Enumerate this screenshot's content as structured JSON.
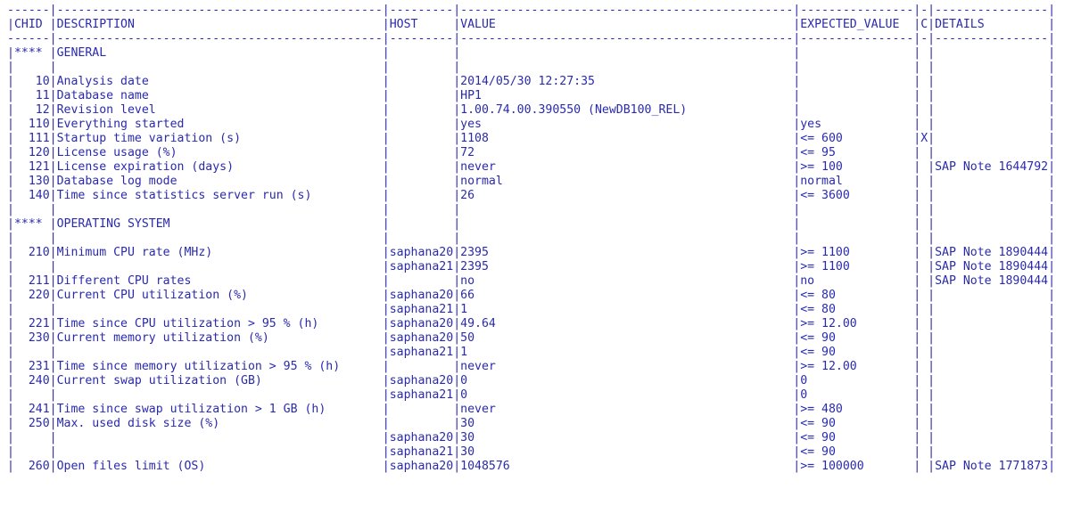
{
  "widths": {
    "chid": 5,
    "description": 46,
    "host": 9,
    "value": 47,
    "expected": 16,
    "c": 1,
    "details": 16
  },
  "header": {
    "chid": "CHID",
    "description": "DESCRIPTION",
    "host": "HOST",
    "value": "VALUE",
    "expected": "EXPECTED_VALUE",
    "c": "C",
    "details": "DETAILS"
  },
  "rows": [
    {
      "section": true,
      "chid": "****",
      "description": "GENERAL"
    },
    {
      "blank": true
    },
    {
      "chid": "10",
      "description": "Analysis date",
      "host": "",
      "value": "2014/05/30 12:27:35",
      "expected": "",
      "c": "",
      "details": ""
    },
    {
      "chid": "11",
      "description": "Database name",
      "host": "",
      "value": "HP1",
      "expected": "",
      "c": "",
      "details": ""
    },
    {
      "chid": "12",
      "description": "Revision level",
      "host": "",
      "value": "1.00.74.00.390550 (NewDB100_REL)",
      "expected": "",
      "c": "",
      "details": ""
    },
    {
      "chid": "110",
      "description": "Everything started",
      "host": "",
      "value": "yes",
      "expected": "yes",
      "c": "",
      "details": ""
    },
    {
      "chid": "111",
      "description": "Startup time variation (s)",
      "host": "",
      "value": "1108",
      "expected": "<= 600",
      "c": "X",
      "details": ""
    },
    {
      "chid": "120",
      "description": "License usage (%)",
      "host": "",
      "value": "72",
      "expected": "<= 95",
      "c": "",
      "details": ""
    },
    {
      "chid": "121",
      "description": "License expiration (days)",
      "host": "",
      "value": "never",
      "expected": ">= 100",
      "c": "",
      "details": "SAP Note 1644792"
    },
    {
      "chid": "130",
      "description": "Database log mode",
      "host": "",
      "value": "normal",
      "expected": "normal",
      "c": "",
      "details": ""
    },
    {
      "chid": "140",
      "description": "Time since statistics server run (s)",
      "host": "",
      "value": "26",
      "expected": "<= 3600",
      "c": "",
      "details": ""
    },
    {
      "blank": true
    },
    {
      "section": true,
      "chid": "****",
      "description": "OPERATING SYSTEM"
    },
    {
      "blank": true
    },
    {
      "chid": "210",
      "description": "Minimum CPU rate (MHz)",
      "host": "saphana20",
      "value": "2395",
      "expected": ">= 1100",
      "c": "",
      "details": "SAP Note 1890444"
    },
    {
      "chid": "",
      "description": "",
      "host": "saphana21",
      "value": "2395",
      "expected": ">= 1100",
      "c": "",
      "details": "SAP Note 1890444"
    },
    {
      "chid": "211",
      "description": "Different CPU rates",
      "host": "",
      "value": "no",
      "expected": "no",
      "c": "",
      "details": "SAP Note 1890444"
    },
    {
      "chid": "220",
      "description": "Current CPU utilization (%)",
      "host": "saphana20",
      "value": "66",
      "expected": "<= 80",
      "c": "",
      "details": ""
    },
    {
      "chid": "",
      "description": "",
      "host": "saphana21",
      "value": "1",
      "expected": "<= 80",
      "c": "",
      "details": ""
    },
    {
      "chid": "221",
      "description": "Time since CPU utilization > 95 % (h)",
      "host": "saphana20",
      "value": "49.64",
      "expected": ">= 12.00",
      "c": "",
      "details": ""
    },
    {
      "chid": "230",
      "description": "Current memory utilization (%)",
      "host": "saphana20",
      "value": "50",
      "expected": "<= 90",
      "c": "",
      "details": ""
    },
    {
      "chid": "",
      "description": "",
      "host": "saphana21",
      "value": "1",
      "expected": "<= 90",
      "c": "",
      "details": ""
    },
    {
      "chid": "231",
      "description": "Time since memory utilization > 95 % (h)",
      "host": "",
      "value": "never",
      "expected": ">= 12.00",
      "c": "",
      "details": ""
    },
    {
      "chid": "240",
      "description": "Current swap utilization (GB)",
      "host": "saphana20",
      "value": "0",
      "expected": "0",
      "c": "",
      "details": ""
    },
    {
      "chid": "",
      "description": "",
      "host": "saphana21",
      "value": "0",
      "expected": "0",
      "c": "",
      "details": ""
    },
    {
      "chid": "241",
      "description": "Time since swap utilization > 1 GB (h)",
      "host": "",
      "value": "never",
      "expected": ">= 480",
      "c": "",
      "details": ""
    },
    {
      "chid": "250",
      "description": "Max. used disk size (%)",
      "host": "",
      "value": "30",
      "expected": "<= 90",
      "c": "",
      "details": ""
    },
    {
      "chid": "",
      "description": "",
      "host": "saphana20",
      "value": "30",
      "expected": "<= 90",
      "c": "",
      "details": ""
    },
    {
      "chid": "",
      "description": "",
      "host": "saphana21",
      "value": "30",
      "expected": "<= 90",
      "c": "",
      "details": ""
    },
    {
      "chid": "260",
      "description": "Open files limit (OS)",
      "host": "saphana20",
      "value": "1048576",
      "expected": ">= 100000",
      "c": "",
      "details": "SAP Note 1771873"
    }
  ]
}
